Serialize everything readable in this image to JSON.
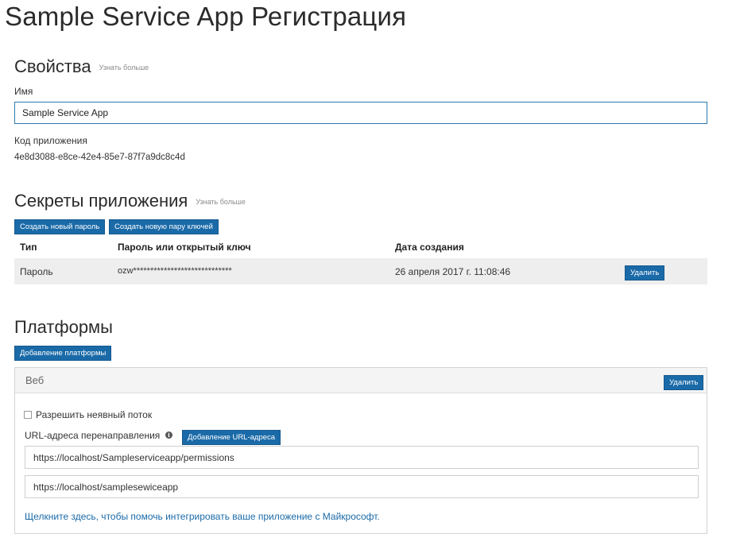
{
  "page": {
    "title": "Sample Service App Регистрация"
  },
  "properties": {
    "heading": "Свойства",
    "learn_more": "Узнать больше",
    "name_label": "Имя",
    "name_value": "Sample Service App",
    "app_id_label": "Код приложения",
    "app_id_value": "4e8d3088-e8ce-42e4-85e7-87f7a9dc8c4d"
  },
  "secrets": {
    "heading": "Секреты приложения",
    "learn_more": "Узнать больше",
    "new_password_button": "Создать новый пароль",
    "new_keypair_button": "Создать новую пару ключей",
    "columns": [
      "Тип",
      "Пароль или открытый ключ",
      "Дата создания"
    ],
    "rows": [
      {
        "type": "Пароль",
        "key": "ozw*****************************",
        "created": "26 апреля 2017 г. 11:08:46",
        "delete_label": "Удалить"
      }
    ]
  },
  "platforms": {
    "heading": "Платформы",
    "add_button": "Добавление платформы",
    "web": {
      "title": "Веб",
      "delete_label": "Удалить",
      "implicit_flow_label": "Разрешить неявный поток",
      "implicit_flow_checked": false,
      "redirect_label": "URL-адреса перенаправления",
      "add_url_button": "Добавление URL-адреса",
      "redirect_urls": [
        "https://localhost/Sampleserviceapp/permissions",
        "https://localhost/samplesewiceapp"
      ],
      "help_link": "Щелкните здесь, чтобы помочь интегрировать ваше приложение с Майкрософт."
    }
  }
}
